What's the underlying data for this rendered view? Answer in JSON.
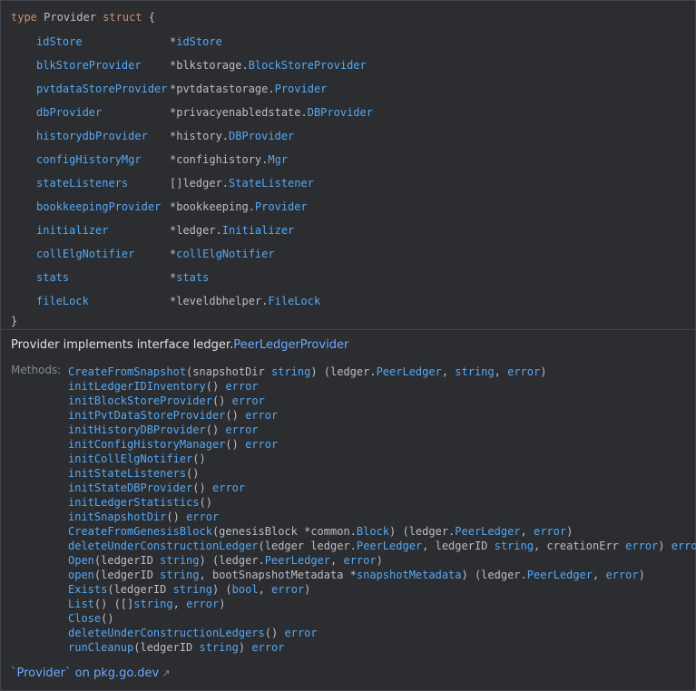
{
  "code": {
    "keyword_type": "type",
    "struct_name": "Provider",
    "keyword_struct": "struct",
    "open_brace": "{",
    "close_brace": "}",
    "fields": [
      {
        "name": "idStore",
        "prefix": "*",
        "pkg": "",
        "type": "idStore"
      },
      {
        "name": "blkStoreProvider",
        "prefix": "*blkstorage.",
        "pkg": "",
        "type": "BlockStoreProvider"
      },
      {
        "name": "pvtdataStoreProvider",
        "prefix": "*pvtdatastorage.",
        "pkg": "",
        "type": "Provider"
      },
      {
        "name": "dbProvider",
        "prefix": "*privacyenabledstate.",
        "pkg": "",
        "type": "DBProvider"
      },
      {
        "name": "historydbProvider",
        "prefix": "*history.",
        "pkg": "",
        "type": "DBProvider"
      },
      {
        "name": "configHistoryMgr",
        "prefix": "*confighistory.",
        "pkg": "",
        "type": "Mgr"
      },
      {
        "name": "stateListeners",
        "prefix": "[]ledger.",
        "pkg": "",
        "type": "StateListener"
      },
      {
        "name": "bookkeepingProvider",
        "prefix": "*bookkeeping.",
        "pkg": "",
        "type": "Provider"
      },
      {
        "name": "initializer",
        "prefix": "*ledger.",
        "pkg": "",
        "type": "Initializer"
      },
      {
        "name": "collElgNotifier",
        "prefix": "*",
        "pkg": "",
        "type": "collElgNotifier"
      },
      {
        "name": "stats",
        "prefix": "*",
        "pkg": "",
        "type": "stats"
      },
      {
        "name": "fileLock",
        "prefix": "*leveldbhelper.",
        "pkg": "",
        "type": "FileLock"
      }
    ]
  },
  "description": {
    "text": "Provider implements interface ledger.",
    "link": "PeerLedgerProvider"
  },
  "methods_label": "Methods:",
  "methods": [
    {
      "name": "CreateFromSnapshot",
      "parts": [
        [
          "(snapshotDir ",
          0
        ],
        [
          "string",
          1
        ],
        [
          ") (ledger.",
          0
        ],
        [
          "PeerLedger",
          1
        ],
        [
          ", ",
          0
        ],
        [
          "string",
          1
        ],
        [
          ", ",
          0
        ],
        [
          "error",
          1
        ],
        [
          ")",
          0
        ]
      ]
    },
    {
      "name": "initLedgerIDInventory",
      "parts": [
        [
          "() ",
          0
        ],
        [
          "error",
          1
        ]
      ]
    },
    {
      "name": "initBlockStoreProvider",
      "parts": [
        [
          "() ",
          0
        ],
        [
          "error",
          1
        ]
      ]
    },
    {
      "name": "initPvtDataStoreProvider",
      "parts": [
        [
          "() ",
          0
        ],
        [
          "error",
          1
        ]
      ]
    },
    {
      "name": "initHistoryDBProvider",
      "parts": [
        [
          "() ",
          0
        ],
        [
          "error",
          1
        ]
      ]
    },
    {
      "name": "initConfigHistoryManager",
      "parts": [
        [
          "() ",
          0
        ],
        [
          "error",
          1
        ]
      ]
    },
    {
      "name": "initCollElgNotifier",
      "parts": [
        [
          "()",
          0
        ]
      ]
    },
    {
      "name": "initStateListeners",
      "parts": [
        [
          "()",
          0
        ]
      ]
    },
    {
      "name": "initStateDBProvider",
      "parts": [
        [
          "() ",
          0
        ],
        [
          "error",
          1
        ]
      ]
    },
    {
      "name": "initLedgerStatistics",
      "parts": [
        [
          "()",
          0
        ]
      ]
    },
    {
      "name": "initSnapshotDir",
      "parts": [
        [
          "() ",
          0
        ],
        [
          "error",
          1
        ]
      ]
    },
    {
      "name": "CreateFromGenesisBlock",
      "parts": [
        [
          "(genesisBlock *common.",
          0
        ],
        [
          "Block",
          1
        ],
        [
          ") (ledger.",
          0
        ],
        [
          "PeerLedger",
          1
        ],
        [
          ", ",
          0
        ],
        [
          "error",
          1
        ],
        [
          ")",
          0
        ]
      ]
    },
    {
      "name": "deleteUnderConstructionLedger",
      "parts": [
        [
          "(ledger ledger.",
          0
        ],
        [
          "PeerLedger",
          1
        ],
        [
          ", ledgerID ",
          0
        ],
        [
          "string",
          1
        ],
        [
          ", creationErr ",
          0
        ],
        [
          "error",
          1
        ],
        [
          ") ",
          0
        ],
        [
          "error",
          1
        ]
      ]
    },
    {
      "name": "Open",
      "parts": [
        [
          "(ledgerID ",
          0
        ],
        [
          "string",
          1
        ],
        [
          ") (ledger.",
          0
        ],
        [
          "PeerLedger",
          1
        ],
        [
          ", ",
          0
        ],
        [
          "error",
          1
        ],
        [
          ")",
          0
        ]
      ]
    },
    {
      "name": "open",
      "parts": [
        [
          "(ledgerID ",
          0
        ],
        [
          "string",
          1
        ],
        [
          ", bootSnapshotMetadata *",
          0
        ],
        [
          "snapshotMetadata",
          1
        ],
        [
          ") (ledger.",
          0
        ],
        [
          "PeerLedger",
          1
        ],
        [
          ", ",
          0
        ],
        [
          "error",
          1
        ],
        [
          ")",
          0
        ]
      ]
    },
    {
      "name": "Exists",
      "parts": [
        [
          "(ledgerID ",
          0
        ],
        [
          "string",
          1
        ],
        [
          ") (",
          0
        ],
        [
          "bool",
          1
        ],
        [
          ", ",
          0
        ],
        [
          "error",
          1
        ],
        [
          ")",
          0
        ]
      ]
    },
    {
      "name": "List",
      "parts": [
        [
          "() ([]",
          0
        ],
        [
          "string",
          1
        ],
        [
          ", ",
          0
        ],
        [
          "error",
          1
        ],
        [
          ")",
          0
        ]
      ]
    },
    {
      "name": "Close",
      "parts": [
        [
          "()",
          0
        ]
      ]
    },
    {
      "name": "deleteUnderConstructionLedgers",
      "parts": [
        [
          "() ",
          0
        ],
        [
          "error",
          1
        ]
      ]
    },
    {
      "name": "runCleanup",
      "parts": [
        [
          "(ledgerID ",
          0
        ],
        [
          "string",
          1
        ],
        [
          ") ",
          0
        ],
        [
          "error",
          1
        ]
      ]
    }
  ],
  "footer": {
    "link_text": "`Provider` on pkg.go.dev",
    "icon": "external-link-icon"
  }
}
